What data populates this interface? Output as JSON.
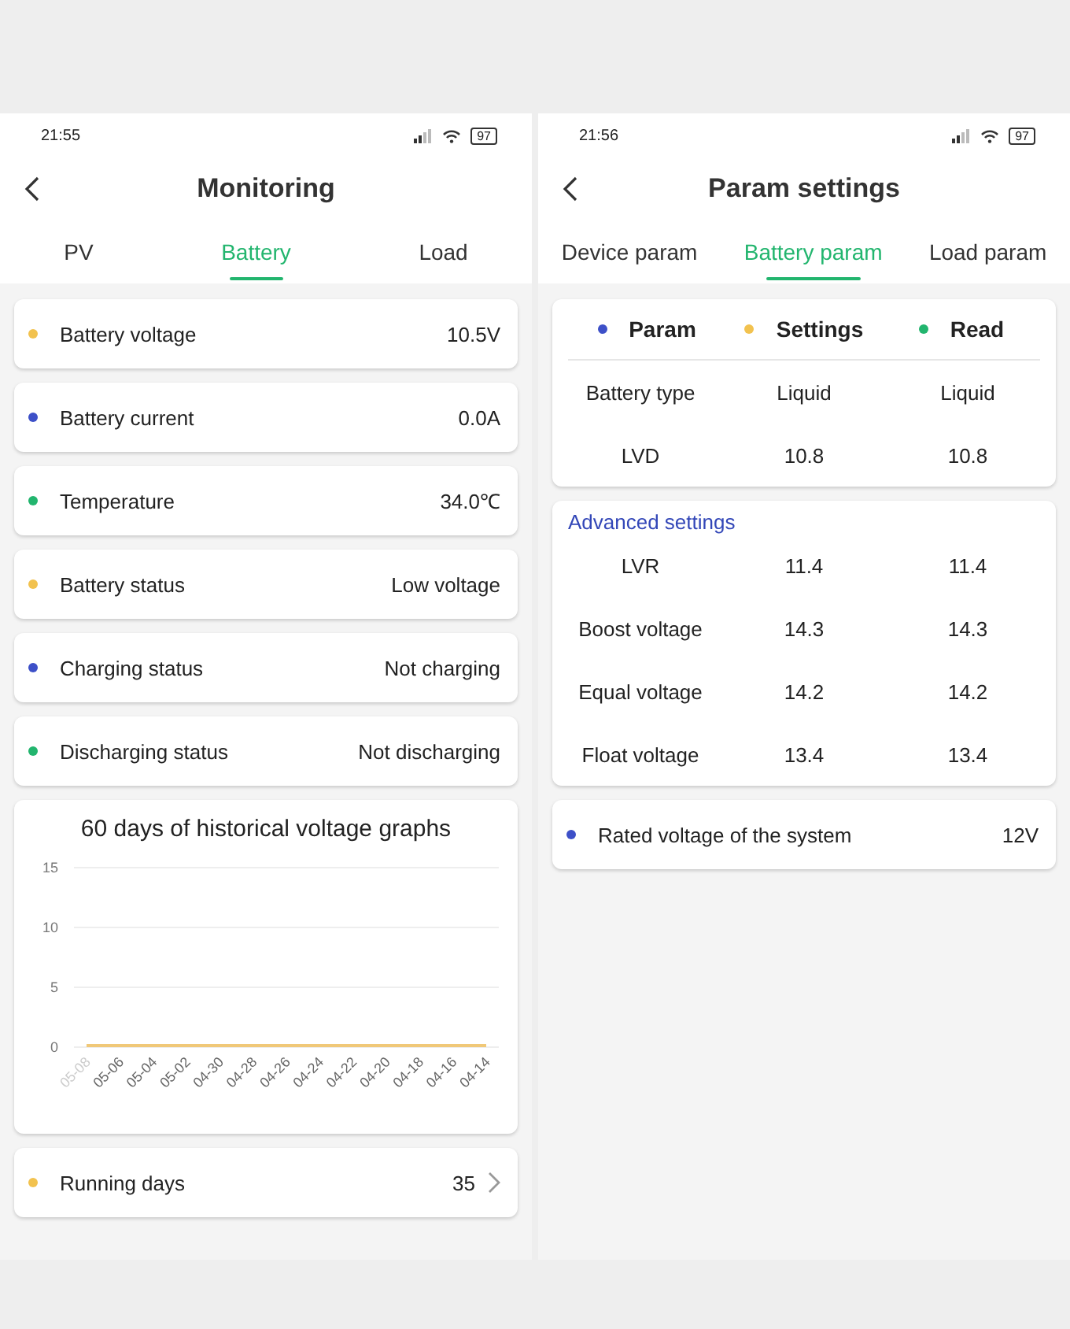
{
  "monitoring": {
    "status_bar": {
      "time": "21:55",
      "battery": "97"
    },
    "title": "Monitoring",
    "tabs": [
      {
        "label": "PV",
        "selected": false
      },
      {
        "label": "Battery",
        "selected": true
      },
      {
        "label": "Load",
        "selected": false
      }
    ],
    "rows": [
      {
        "label": "Battery voltage",
        "value": "10.5V",
        "color": "#f2c24f"
      },
      {
        "label": "Battery current",
        "value": "0.0A",
        "color": "#3d50c8"
      },
      {
        "label": "Temperature",
        "value": "34.0℃",
        "color": "#22b56e"
      },
      {
        "label": "Battery status",
        "value": "Low voltage",
        "color": "#f2c24f"
      },
      {
        "label": "Charging status",
        "value": "Not charging",
        "color": "#3d50c8"
      },
      {
        "label": "Discharging status",
        "value": "Not discharging",
        "color": "#22b56e"
      }
    ],
    "chart_card": {
      "chart_data": {
        "type": "line",
        "title": "60 days of historical voltage graphs",
        "categories": [
          "05-08",
          "05-06",
          "05-04",
          "05-02",
          "04-30",
          "04-28",
          "04-26",
          "04-24",
          "04-22",
          "04-20",
          "04-18",
          "04-16",
          "04-14"
        ],
        "series": [
          {
            "color": "#f0c878",
            "values": [
              0,
              0,
              0,
              0,
              0,
              0,
              0,
              0,
              0,
              0,
              0,
              0,
              0
            ]
          }
        ],
        "ylim": [
          0,
          15
        ],
        "yticks": [
          0,
          5,
          10,
          15
        ]
      }
    },
    "running_row": {
      "label": "Running days",
      "value": "35",
      "color": "#f2c24f"
    }
  },
  "param_settings": {
    "status_bar": {
      "time": "21:56",
      "battery": "97"
    },
    "title": "Param settings",
    "tabs": [
      {
        "label": "Device param",
        "selected": false
      },
      {
        "label": "Battery param",
        "selected": true
      },
      {
        "label": "Load param",
        "selected": false
      }
    ],
    "columns": [
      {
        "label": "Param",
        "color": "#3d50c8"
      },
      {
        "label": "Settings",
        "color": "#f2c24f"
      },
      {
        "label": "Read",
        "color": "#22b56e"
      }
    ],
    "basic_rows": [
      {
        "name": "Battery type",
        "setting": "Liquid",
        "read": "Liquid"
      },
      {
        "name": "LVD",
        "setting": "10.8",
        "read": "10.8"
      }
    ],
    "advanced_title": "Advanced settings",
    "advanced_rows": [
      {
        "name": "LVR",
        "setting": "11.4",
        "read": "11.4"
      },
      {
        "name": "Boost voltage",
        "setting": "14.3",
        "read": "14.3"
      },
      {
        "name": "Equal voltage",
        "setting": "14.2",
        "read": "14.2"
      },
      {
        "name": "Float voltage",
        "setting": "13.4",
        "read": "13.4"
      }
    ],
    "rated_row": {
      "label": "Rated voltage of the system",
      "value": "12V",
      "color": "#3d50c8"
    }
  }
}
